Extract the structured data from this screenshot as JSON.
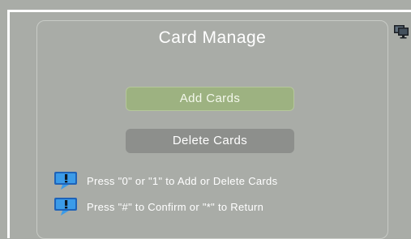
{
  "screen": {
    "title": "Card Manage"
  },
  "buttons": {
    "add_label": "Add Cards",
    "delete_label": "Delete Cards"
  },
  "hints": [
    {
      "icon": "info-speech-bubble-icon",
      "text": "Press \"0\" or \"1\" to Add or Delete Cards"
    },
    {
      "icon": "info-speech-bubble-icon",
      "text": "Press \"#\" to Confirm or \"*\" to Return"
    }
  ],
  "status": {
    "icon": "monitor-icon"
  },
  "colors": {
    "background": "#a9aca7",
    "add_button": "#9db281",
    "delete_button": "#8d8f8c",
    "hint_icon_blue": "#2f8fe0"
  }
}
